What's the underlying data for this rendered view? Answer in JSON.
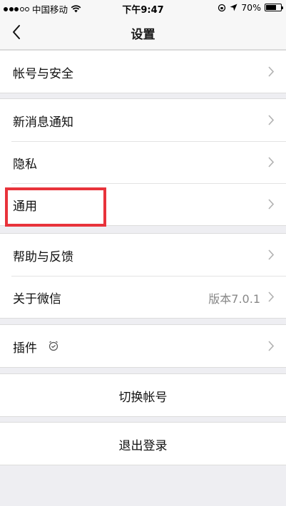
{
  "status_bar": {
    "carrier": "中国移动",
    "time": "下午9:47",
    "battery": "70%",
    "battery_level": 0.7
  },
  "nav": {
    "title": "设置",
    "back_icon": "chevron-left-icon"
  },
  "groups": [
    {
      "items": [
        {
          "label": "帐号与安全"
        }
      ]
    },
    {
      "items": [
        {
          "label": "新消息通知"
        },
        {
          "label": "隐私"
        },
        {
          "label": "通用"
        }
      ]
    },
    {
      "items": [
        {
          "label": "帮助与反馈"
        },
        {
          "label": "关于微信",
          "value": "版本7.0.1"
        }
      ]
    },
    {
      "items": [
        {
          "label": "插件",
          "icon": "plugin-icon"
        }
      ]
    },
    {
      "items": [
        {
          "label": "切换帐号"
        }
      ]
    },
    {
      "items": [
        {
          "label": "退出登录"
        }
      ]
    }
  ],
  "colors": {
    "highlight": "#e8333b",
    "background": "#eeeef2"
  }
}
